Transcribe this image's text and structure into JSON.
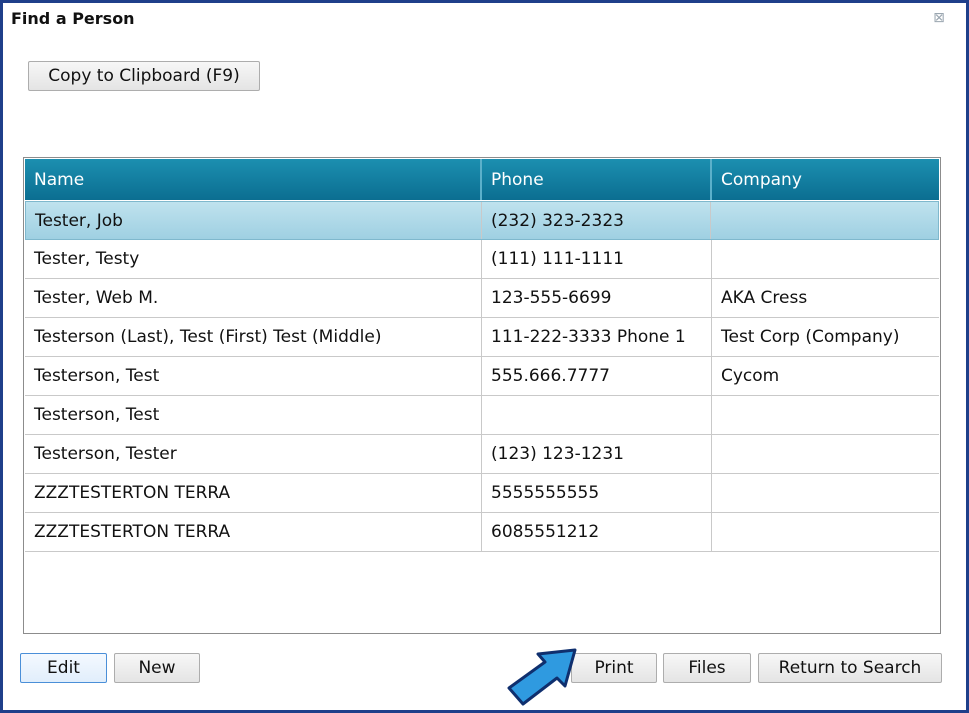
{
  "window": {
    "title": "Find a Person",
    "close_glyph": "⊠"
  },
  "toolbar": {
    "copy_label": "Copy to Clipboard (F9)"
  },
  "table": {
    "columns": [
      "Name",
      "Phone",
      "Company"
    ],
    "rows": [
      [
        "Tester, Job",
        "(232) 323-2323",
        ""
      ],
      [
        "Tester, Testy",
        "(111) 111-1111",
        ""
      ],
      [
        "Tester, Web M.",
        "123-555-6699",
        "AKA Cress"
      ],
      [
        "Testerson (Last), Test (First) Test (Middle)",
        "111-222-3333 Phone 1",
        "Test Corp (Company)"
      ],
      [
        "Testerson, Test",
        "555.666.7777",
        "Cycom"
      ],
      [
        "Testerson, Test",
        "",
        ""
      ],
      [
        "Testerson, Tester",
        "(123) 123-1231",
        ""
      ],
      [
        "ZZZTESTERTON TERRA",
        "5555555555",
        ""
      ],
      [
        "ZZZTESTERTON TERRA",
        "6085551212",
        ""
      ]
    ],
    "selected_row": 0
  },
  "footer": {
    "edit_label": "Edit",
    "new_label": "New",
    "print_label": "Print",
    "files_label": "Files",
    "return_label": "Return to Search"
  },
  "colors": {
    "header_top": "#1c8fb0",
    "header_bottom": "#0b6e91",
    "selection": "#acd8e8",
    "frame": "#1f3f8a",
    "arrow_fill": "#2f9ae0"
  }
}
